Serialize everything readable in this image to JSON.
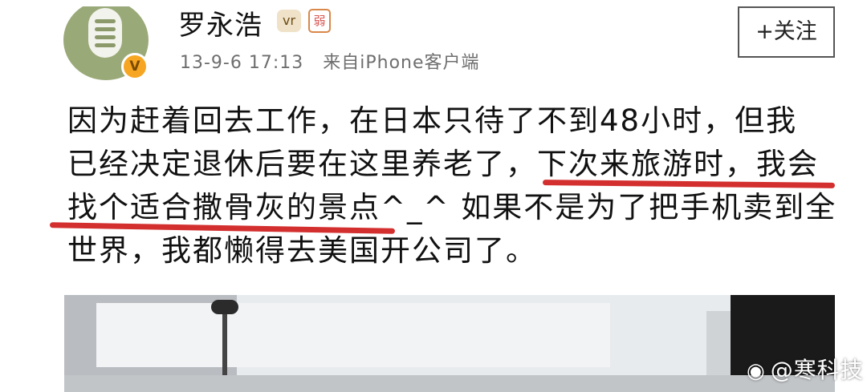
{
  "post": {
    "author": "罗永浩",
    "verified_mark": "V",
    "badge_1": "vr",
    "badge_2": "弱",
    "timestamp": "13-9-6 17:13",
    "source": "来自iPhone客户端",
    "follow_label": "+关注",
    "text_lines": [
      "因为赶着回去工作，在日本只待了不到48小时，但我",
      "已经决定退休后要在这里养老了，下次来旅游时，我会",
      "找个适合撒骨灰的景点^_^ 如果不是为了把手机卖到全",
      "世界，我都懒得去美国开公司了。"
    ]
  },
  "watermark": {
    "text": "@寒科技",
    "icon": "weibo-icon"
  },
  "colors": {
    "underline": "#d32f2f",
    "verified": "#f6a623",
    "avatar": "#9aa978"
  }
}
